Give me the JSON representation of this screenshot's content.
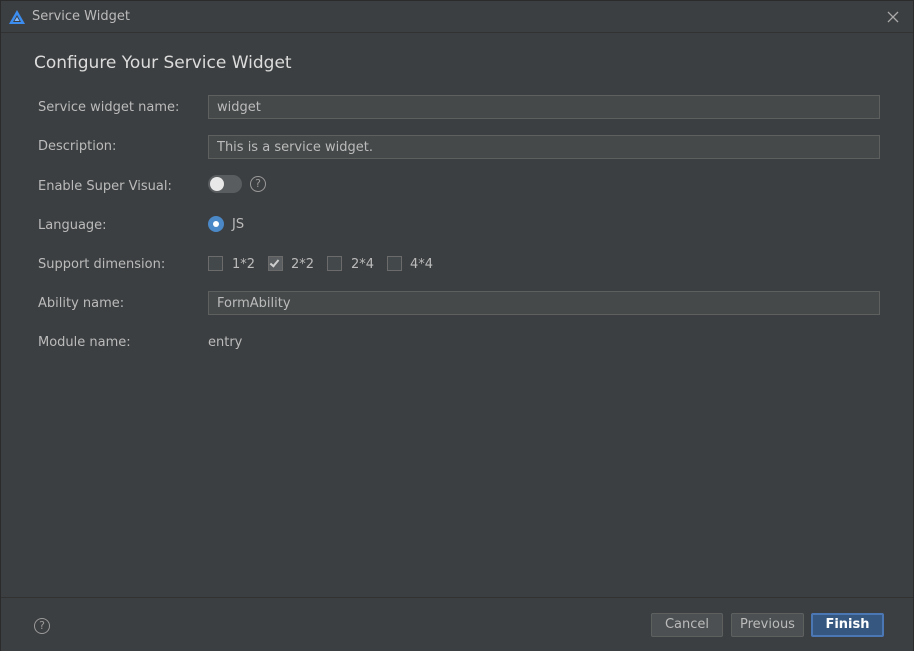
{
  "window": {
    "title": "Service Widget",
    "heading": "Configure Your Service Widget"
  },
  "form": {
    "service_widget_name": {
      "label": "Service widget name:",
      "value": "widget"
    },
    "description": {
      "label": "Description:",
      "value": "This is a service widget."
    },
    "enable_super_visual": {
      "label": "Enable Super Visual:",
      "enabled": false,
      "help": "?"
    },
    "language": {
      "label": "Language:",
      "options": [
        {
          "label": "JS",
          "selected": true
        }
      ]
    },
    "support_dimension": {
      "label": "Support dimension:",
      "options": [
        {
          "label": "1*2",
          "checked": false
        },
        {
          "label": "2*2",
          "checked": true
        },
        {
          "label": "2*4",
          "checked": false
        },
        {
          "label": "4*4",
          "checked": false
        }
      ]
    },
    "ability_name": {
      "label": "Ability name:",
      "value": "FormAbility"
    },
    "module_name": {
      "label": "Module name:",
      "value": "entry"
    }
  },
  "footer": {
    "help": "?",
    "cancel_label": "Cancel",
    "previous_label": "Previous",
    "finish_label": "Finish"
  },
  "colors": {
    "background": "#3c3f41",
    "field_bg": "#45494a",
    "accent": "#4a88c7",
    "primary_button": "#365880"
  },
  "icons": {
    "app": "deveco-triangle-icon",
    "close": "close-icon",
    "help": "help-circle-icon"
  }
}
